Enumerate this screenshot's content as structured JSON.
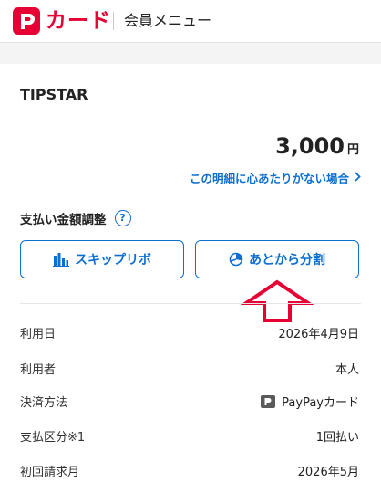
{
  "header": {
    "logo_text": "カード",
    "title": "会員メニュー"
  },
  "detail": {
    "merchant": "TIPSTAR",
    "amount": "3,000",
    "unit": "円",
    "inquiry_link": "この明細に心あたりがない場合"
  },
  "adjust": {
    "label": "支払い金額調整",
    "help": "?",
    "skip_button": "スキップリボ",
    "later_button": "あとから分割"
  },
  "rows": [
    {
      "label": "利用日",
      "value": "2026年4月9日"
    },
    {
      "label": "利用者",
      "value": "本人"
    },
    {
      "label": "決済方法",
      "value": "PayPayカード"
    },
    {
      "label": "支払区分※1",
      "value": "1回払い"
    },
    {
      "label": "初回請求月",
      "value": "2026年5月"
    }
  ],
  "colors": {
    "brand_red": "#e60033",
    "link_blue": "#0f6fd1",
    "arrow_red": "#e60033"
  },
  "icons": {
    "logo": "paypay-logo-icon",
    "skip": "bar-chart-icon",
    "later": "pie-chart-icon",
    "chevron": "chevron-right-icon",
    "arrow": "up-arrow-annotation-icon"
  }
}
